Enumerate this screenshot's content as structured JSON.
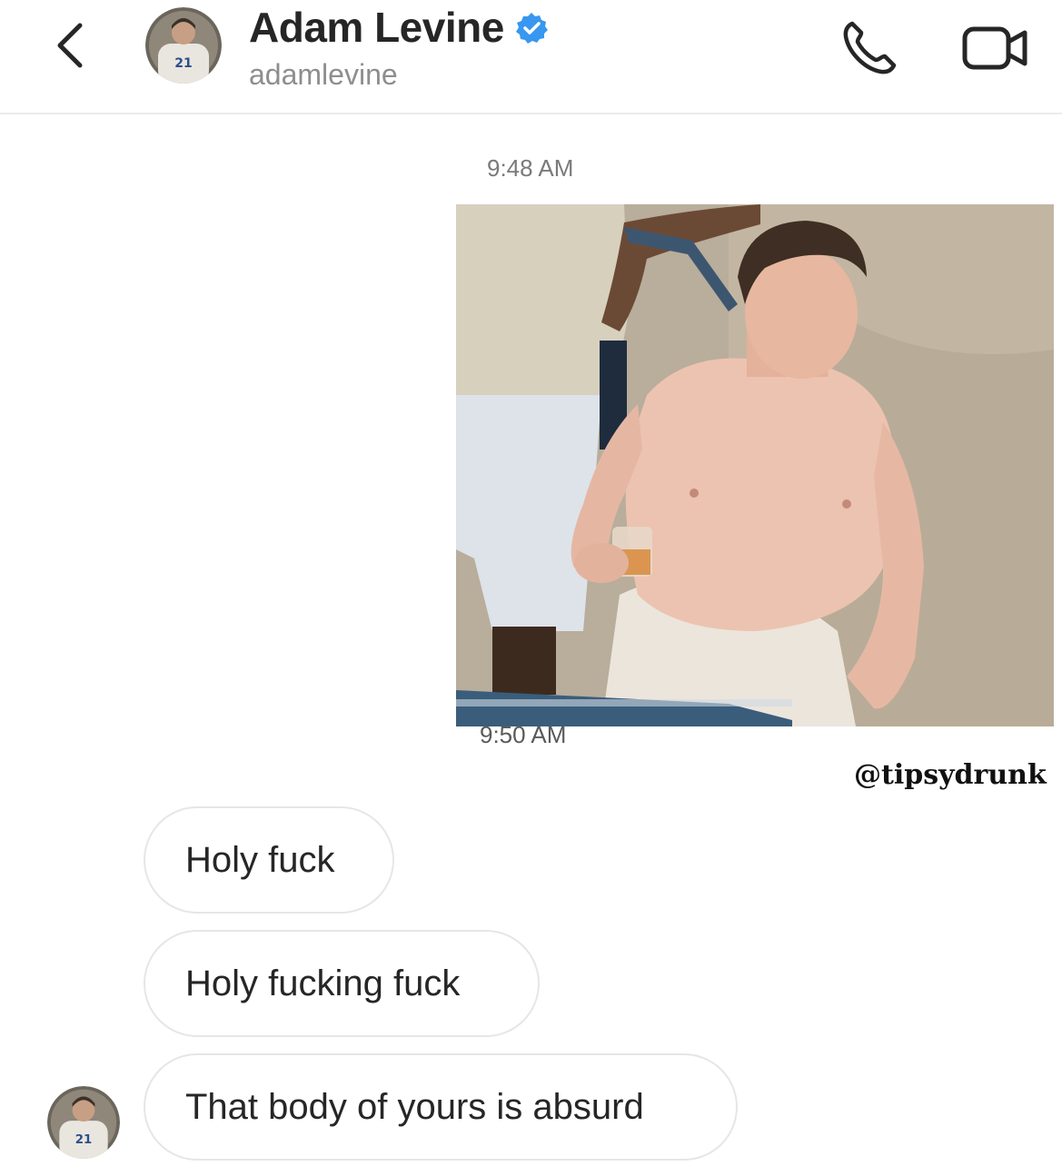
{
  "header": {
    "contact_name": "Adam Levine",
    "username": "adamlevine",
    "back_icon": "chevron-left-icon",
    "verified_icon": "verified-badge-icon",
    "call_icon": "phone-icon",
    "video_icon": "video-camera-icon"
  },
  "colors": {
    "verified_blue": "#3897f0",
    "bubble_border": "#e6e6e6",
    "text": "#262626",
    "muted": "#8e8e8e"
  },
  "messages": {
    "timestamp_1": "9:48 AM",
    "timestamp_2": "9:50 AM",
    "received": [
      {
        "text": "Holy fuck"
      },
      {
        "text": "Holy fucking fuck"
      },
      {
        "text": "That body of yours is absurd"
      }
    ]
  },
  "watermark": "@tipsydrunk"
}
